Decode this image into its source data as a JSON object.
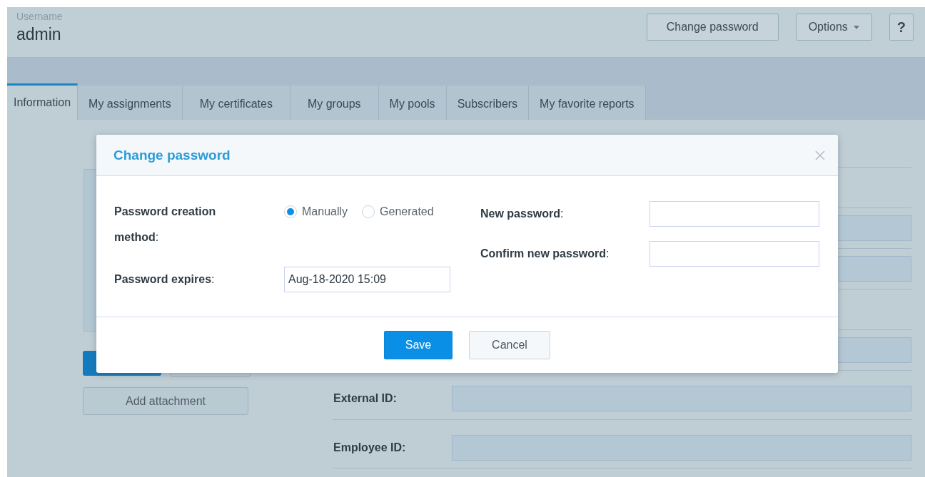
{
  "header": {
    "caption": "Username",
    "name": "admin",
    "buttons": [
      {
        "kind": "text",
        "label": "Change password"
      },
      {
        "kind": "menu",
        "label": "Options"
      },
      {
        "kind": "help",
        "label": "?"
      }
    ]
  },
  "tabs": [
    {
      "label": "Information",
      "selected": true
    },
    {
      "label": "My assignments",
      "selected": false
    },
    {
      "label": "My certificates",
      "selected": false
    },
    {
      "label": "My groups",
      "selected": false
    },
    {
      "label": "My pools",
      "selected": false
    },
    {
      "label": "Subscribers",
      "selected": false
    },
    {
      "label": "My favorite reports",
      "selected": false
    }
  ],
  "profile": {
    "attachment_button": "Add attachment",
    "rows": [
      {
        "kind": "blank"
      },
      {
        "kind": "field"
      },
      {
        "kind": "field"
      },
      {
        "kind": "blank"
      },
      {
        "kind": "field"
      },
      {
        "kind": "field",
        "label": "External ID:"
      },
      {
        "kind": "field",
        "label": "Employee ID:"
      }
    ]
  },
  "dialog": {
    "title": "Change password",
    "method_label": "**Password creation method**:",
    "methods": [
      {
        "label": "Manually",
        "selected": true
      },
      {
        "label": "Generated",
        "selected": false
      }
    ],
    "expires_label": "**Password expires**:",
    "expires_value": "Aug-18-2020 15:09",
    "fields": [
      {
        "label": "**New password**:"
      },
      {
        "label": "**Confirm new password**:"
      }
    ],
    "buttons": [
      {
        "kind": "primary",
        "label": "Save"
      },
      {
        "kind": "secondary",
        "label": "Cancel"
      }
    ]
  }
}
